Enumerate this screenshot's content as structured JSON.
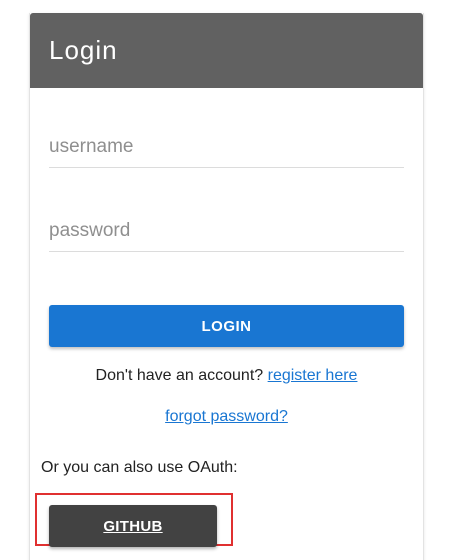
{
  "header": {
    "title": "Login"
  },
  "form": {
    "username_placeholder": "username",
    "username_value": "",
    "password_placeholder": "password",
    "password_value": "",
    "login_label": "LOGIN"
  },
  "links": {
    "register_prompt": "Don't have an account?",
    "register_label": "register here",
    "forgot_label": "forgot password?"
  },
  "oauth": {
    "prompt": "Or you can also use OAuth:",
    "github_label": "GITHUB"
  },
  "colors": {
    "header_bg": "#616161",
    "primary": "#1976d2",
    "github_bg": "#424242",
    "highlight": "#e03030"
  }
}
